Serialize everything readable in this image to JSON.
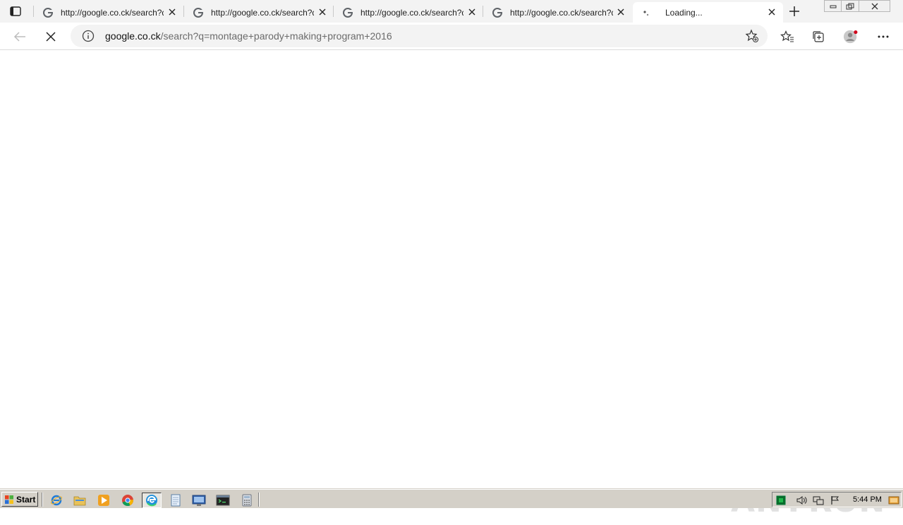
{
  "browser": {
    "tabs": [
      {
        "title": "http://google.co.ck/search?q=montage",
        "favicon": "google-g-icon",
        "active": false
      },
      {
        "title": "http://google.co.ck/search?q=montage",
        "favicon": "google-g-icon",
        "active": false
      },
      {
        "title": "http://google.co.ck/search?q=montage",
        "favicon": "google-g-icon",
        "active": false
      },
      {
        "title": "http://google.co.ck/search?q=montage",
        "favicon": "google-g-icon",
        "active": false
      },
      {
        "title": "Loading...",
        "favicon": "loading-spinner-icon",
        "active": true
      }
    ],
    "address": {
      "host": "google.co.ck",
      "path": "/search?q=montage+parody+making+program+2016"
    }
  },
  "watermark": {
    "left": "ANY",
    "right": "RUN"
  },
  "taskbar": {
    "start_label": "Start",
    "clock": "5:44 PM"
  },
  "colors": {
    "tab_bar": "#f3f3f3",
    "address_bar": "#f3f3f3",
    "taskbar": "#d4d0c8",
    "watermark": "#e1e1e1"
  }
}
